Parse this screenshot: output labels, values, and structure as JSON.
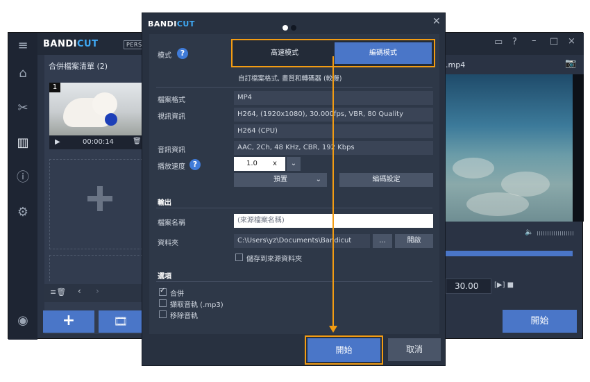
{
  "brand": {
    "left": "BANDI",
    "right": "CUT",
    "edition": "PERSONAL"
  },
  "main": {
    "list_title": "合併檔案清單 (2)",
    "clip": {
      "number": "1",
      "duration": "00:00:14"
    },
    "file_name_partial": ".mp4",
    "time_value": "30.00",
    "start_label": "開始"
  },
  "dialog": {
    "mode_label": "模式",
    "mode_fast": "高速模式",
    "mode_encode": "編碼模式",
    "mode_hint": "自訂檔案格式, 畫質和轉碼器 (較慢)",
    "format_label": "檔案格式",
    "format_value": "MP4",
    "video_label": "視訊資訊",
    "video_value": "H264, (1920x1080), 30.000fps, VBR, 80 Quality",
    "video_value2": "H264 (CPU)",
    "audio_label": "音訊資訊",
    "audio_value": "AAC, 2Ch, 48 KHz, CBR, 192 Kbps",
    "speed_label": "播放速度",
    "speed_value": "1.0",
    "speed_unit": "x",
    "preset_label": "預置",
    "encode_settings_label": "編碼設定",
    "output_section": "輸出",
    "filename_label": "檔案名稱",
    "filename_placeholder": "(來源檔案名稱)",
    "folder_label": "資料夾",
    "folder_value": "C:\\Users\\yz\\Documents\\Bandicut",
    "browse_label": "...",
    "open_label": "開啟",
    "save_to_source": "儲存到來源資料夾",
    "options_section": "選項",
    "opt_merge": "合併",
    "opt_extract_audio": "擷取音軌 (.mp3)",
    "opt_remove_audio": "移除音軌",
    "start_label": "開始",
    "cancel_label": "取消"
  },
  "colors": {
    "accent": "#4a76c8",
    "highlight": "#f39c12",
    "dialog_bg": "#283140"
  }
}
